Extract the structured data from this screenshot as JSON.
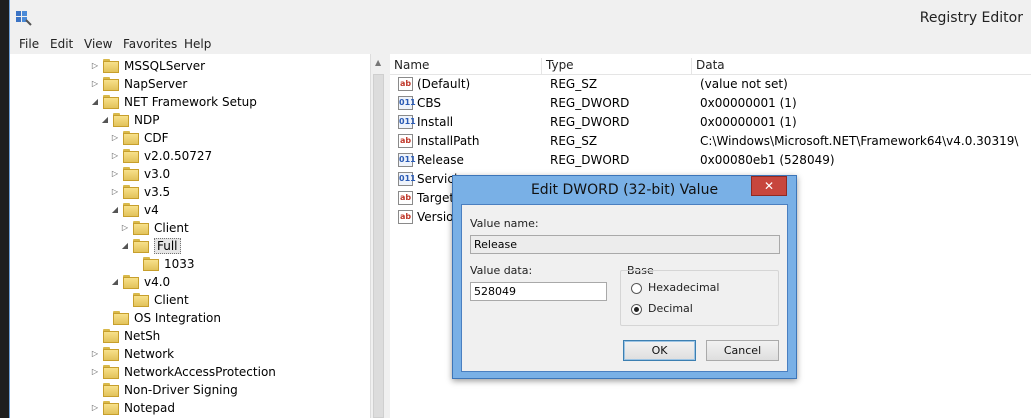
{
  "window": {
    "title": "Registry Editor",
    "app_icon": "regedit-icon"
  },
  "menu": [
    "File",
    "Edit",
    "View",
    "Favorites",
    "Help"
  ],
  "tree": [
    {
      "label": "MSSQLServer",
      "arrow": "collapsed"
    },
    {
      "label": "NapServer",
      "arrow": "collapsed"
    },
    {
      "label": "NET Framework Setup",
      "arrow": "expanded"
    },
    {
      "label": "NDP",
      "arrow": "expanded"
    },
    {
      "label": "CDF",
      "arrow": "collapsed"
    },
    {
      "label": "v2.0.50727",
      "arrow": "collapsed"
    },
    {
      "label": "v3.0",
      "arrow": "collapsed"
    },
    {
      "label": "v3.5",
      "arrow": "collapsed"
    },
    {
      "label": "v4",
      "arrow": "expanded"
    },
    {
      "label": "Client",
      "arrow": "collapsed"
    },
    {
      "label": "Full",
      "arrow": "expanded",
      "selected": true
    },
    {
      "label": "1033",
      "arrow": "none"
    },
    {
      "label": "v4.0",
      "arrow": "expanded"
    },
    {
      "label": "Client",
      "arrow": "none"
    },
    {
      "label": "OS Integration",
      "arrow": "none"
    },
    {
      "label": "NetSh",
      "arrow": "none"
    },
    {
      "label": "Network",
      "arrow": "collapsed"
    },
    {
      "label": "NetworkAccessProtection",
      "arrow": "collapsed"
    },
    {
      "label": "Non-Driver Signing",
      "arrow": "none"
    },
    {
      "label": "Notepad",
      "arrow": "collapsed"
    }
  ],
  "list": {
    "columns": [
      "Name",
      "Type",
      "Data"
    ],
    "rows": [
      {
        "name": "(Default)",
        "type": "REG_SZ",
        "data": "(value not set)",
        "icon": "sz"
      },
      {
        "name": "CBS",
        "type": "REG_DWORD",
        "data": "0x00000001 (1)",
        "icon": "dw"
      },
      {
        "name": "Install",
        "type": "REG_DWORD",
        "data": "0x00000001 (1)",
        "icon": "dw"
      },
      {
        "name": "InstallPath",
        "type": "REG_SZ",
        "data": "C:\\Windows\\Microsoft.NET\\Framework64\\v4.0.30319\\",
        "icon": "sz"
      },
      {
        "name": "Release",
        "type": "REG_DWORD",
        "data": "0x00080eb1 (528049)",
        "icon": "dw"
      },
      {
        "name": "Servicing",
        "type": "",
        "data": "",
        "icon": "dw"
      },
      {
        "name": "TargetVe",
        "type": "",
        "data": "",
        "icon": "sz"
      },
      {
        "name": "Version",
        "type": "",
        "data": "",
        "icon": "sz"
      }
    ]
  },
  "dialog": {
    "title": "Edit DWORD (32-bit) Value",
    "close_label": "✕",
    "value_name_label": "Value name:",
    "value_name": "Release",
    "value_data_label": "Value data:",
    "value_data": "528049",
    "base_label": "Base",
    "hex_label": "Hexadecimal",
    "dec_label": "Decimal",
    "base_selected": "Decimal",
    "ok_label": "OK",
    "cancel_label": "Cancel"
  }
}
